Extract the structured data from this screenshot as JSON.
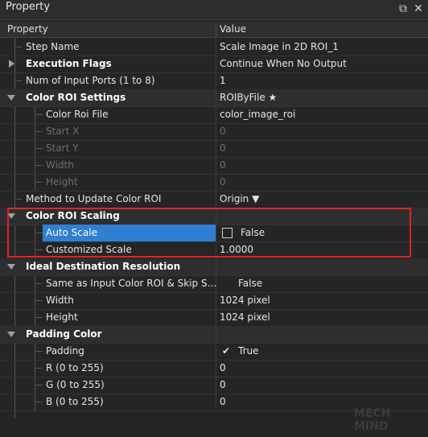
{
  "window": {
    "title": "Property",
    "restore_icon": "restore-icon",
    "close_icon": "close-icon"
  },
  "header": {
    "col_property": "Property",
    "col_value": "Value"
  },
  "rows": {
    "step_name": {
      "name": "Step Name",
      "value": "Scale Image in 2D ROI_1"
    },
    "execution_flags": {
      "name": "Execution Flags",
      "value": "Continue When No Output"
    },
    "num_input_ports": {
      "name": "Num of Input Ports (1 to 8)",
      "value": "1"
    },
    "color_roi_settings": {
      "name": "Color ROI Settings",
      "value": "ROIByFile ★"
    },
    "color_roi_file": {
      "name": "Color Roi File",
      "value": "color_image_roi"
    },
    "start_x": {
      "name": "Start X",
      "value": "0"
    },
    "start_y": {
      "name": "Start Y",
      "value": "0"
    },
    "width_roi": {
      "name": "Width",
      "value": "0"
    },
    "height_roi": {
      "name": "Height",
      "value": "0"
    },
    "method_update": {
      "name": "Method to Update Color ROI",
      "value": "Origin ▼"
    },
    "color_roi_scaling": {
      "name": "Color ROI Scaling"
    },
    "auto_scale": {
      "name": "Auto Scale",
      "value": "False",
      "checked": false
    },
    "customized_scale": {
      "name": "Customized Scale",
      "value": "1.0000"
    },
    "ideal_dest_res": {
      "name": "Ideal Destination Resolution"
    },
    "same_as_input": {
      "name": "Same as Input Color ROI & Skip S...",
      "value": "False"
    },
    "width_dest": {
      "name": "Width",
      "value": "1024 pixel"
    },
    "height_dest": {
      "name": "Height",
      "value": "1024 pixel"
    },
    "padding_color": {
      "name": "Padding Color"
    },
    "padding": {
      "name": "Padding",
      "value": "True",
      "check_mark": "✔"
    },
    "r_value": {
      "name": "R (0 to 255)",
      "value": "0"
    },
    "g_value": {
      "name": "G (0 to 255)",
      "value": "0"
    },
    "b_value": {
      "name": "B (0 to 255)",
      "value": "0"
    }
  },
  "colors": {
    "selection": "#2f7fd2",
    "highlight_border": "#e02424",
    "background": "#252526"
  },
  "watermark": "MECH MIND"
}
